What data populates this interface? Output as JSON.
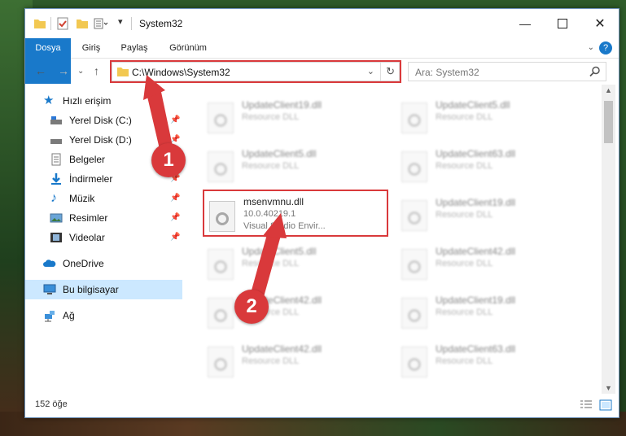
{
  "window": {
    "title": "System32"
  },
  "ribbon": {
    "file": "Dosya",
    "home": "Giriş",
    "share": "Paylaş",
    "view": "Görünüm",
    "help": "?"
  },
  "address": {
    "path": "C:\\Windows\\System32"
  },
  "search": {
    "placeholder": "Ara: System32"
  },
  "sidebar": {
    "quick_access": "Hızlı erişim",
    "items": [
      {
        "label": "Yerel Disk (C:)"
      },
      {
        "label": "Yerel Disk (D:)"
      },
      {
        "label": "Belgeler"
      },
      {
        "label": "İndirmeler"
      },
      {
        "label": "Müzik"
      },
      {
        "label": "Resimler"
      },
      {
        "label": "Videolar"
      }
    ],
    "onedrive": "OneDrive",
    "this_pc": "Bu bilgisayar",
    "network": "Ağ"
  },
  "files": {
    "left": [
      {
        "name": "UpdateClient19.dll",
        "desc": "Resource DLL"
      },
      {
        "name": "UpdateClient5.dll",
        "desc": "Resource DLL"
      },
      {
        "name": "msenvmnu.dll",
        "version": "10.0.40219.1",
        "desc": "Visual Studio Envir..."
      },
      {
        "name": "UpdateClient5.dll",
        "desc": "Resource DLL"
      },
      {
        "name": "UpdateClient42.dll",
        "desc": "Resource DLL"
      },
      {
        "name": "UpdateClient42.dll",
        "desc": "Resource DLL"
      }
    ],
    "right": [
      {
        "name": "UpdateClient5.dll",
        "desc": "Resource DLL"
      },
      {
        "name": "UpdateClient63.dll",
        "desc": "Resource DLL"
      },
      {
        "name": "UpdateClient19.dll",
        "desc": "Resource DLL"
      },
      {
        "name": "UpdateClient42.dll",
        "desc": "Resource DLL"
      },
      {
        "name": "UpdateClient19.dll",
        "desc": "Resource DLL"
      },
      {
        "name": "UpdateClient63.dll",
        "desc": "Resource DLL"
      }
    ]
  },
  "status": {
    "count": "152 öğe"
  },
  "annotations": {
    "step1": "1",
    "step2": "2"
  },
  "colors": {
    "accent": "#1979ca",
    "highlight": "#d9393b",
    "selection": "#cce8ff"
  }
}
